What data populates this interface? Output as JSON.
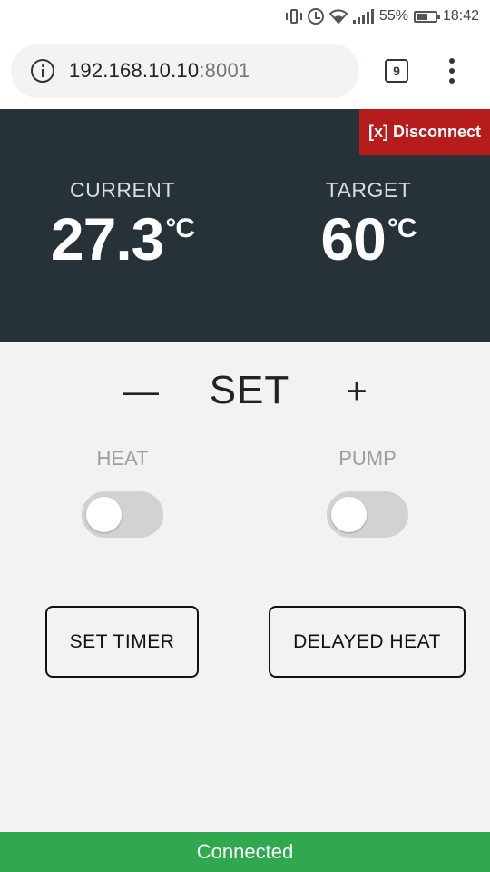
{
  "statusbar": {
    "battery_percent": "55%",
    "time": "18:42",
    "icons": [
      "vibrate-icon",
      "alarm-icon",
      "wifi-icon",
      "signal-icon",
      "battery-icon"
    ]
  },
  "browser": {
    "url_host": "192.168.10.10",
    "url_port": ":8001",
    "tab_count": "9"
  },
  "header": {
    "disconnect_label": "[x] Disconnect",
    "current": {
      "label": "CURRENT",
      "value": "27.3",
      "unit": "°C"
    },
    "target": {
      "label": "TARGET",
      "value": "60",
      "unit": "°C"
    }
  },
  "controls": {
    "minus_label": "—",
    "set_label": "SET",
    "plus_label": "+",
    "heat": {
      "label": "HEAT",
      "on": false
    },
    "pump": {
      "label": "PUMP",
      "on": false
    },
    "set_timer_label": "SET TIMER",
    "delayed_heat_label": "DELAYED HEAT"
  },
  "footer": {
    "status": "Connected"
  },
  "colors": {
    "panel_bg": "#263238",
    "disconnect_bg": "#b71c1c",
    "footer_bg": "#2fa84f",
    "page_bg": "#f2f2f2"
  }
}
